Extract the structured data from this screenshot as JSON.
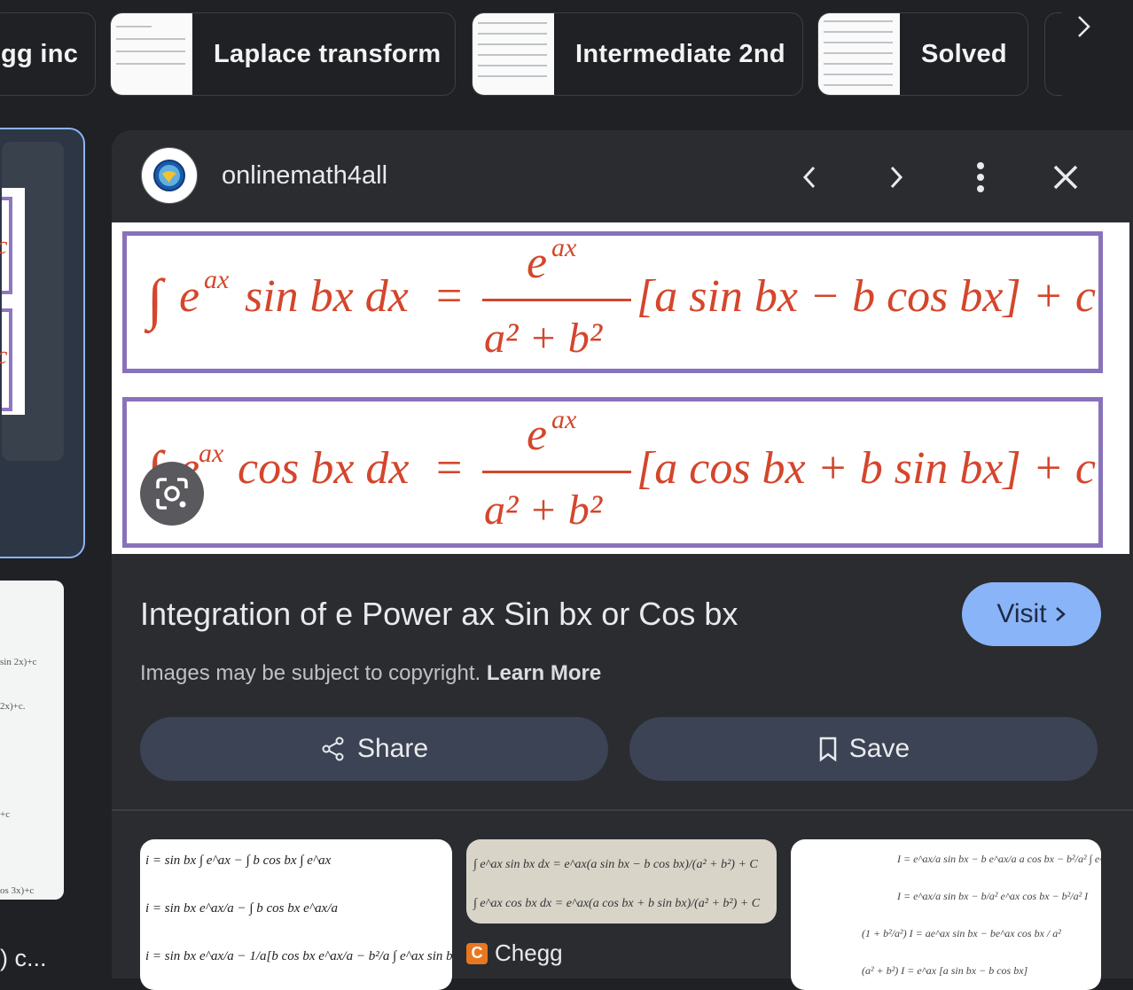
{
  "chips": [
    {
      "label": "gg inc"
    },
    {
      "label": "Laplace transform"
    },
    {
      "label": "Intermediate 2nd"
    },
    {
      "label": "Solved"
    }
  ],
  "left_card": {
    "line1": "c",
    "line2": "c",
    "caption": ") c..."
  },
  "left_bottom": {
    "l1": "sin 2x)+c",
    "l2": "2x)+c.",
    "l3": "+c",
    "l4": "os 3x)+c"
  },
  "panel": {
    "source_name": "onlinemath4all",
    "formula_top": {
      "integrand": "e",
      "exp": "ax",
      "mid": "sin bx dx",
      "eq": "=",
      "num": "e",
      "num_exp": "ax",
      "den": "a² + b²",
      "bracket": "[a sin bx − b cos bx] + c"
    },
    "formula_bottom": {
      "integrand": "e",
      "exp": "ax",
      "mid": "cos bx dx",
      "eq": "=",
      "num": "e",
      "num_exp": "ax",
      "den": "a² + b²",
      "bracket": "[a cos bx + b sin bx] + c"
    },
    "title": "Integration of e Power ax Sin bx or Cos bx",
    "visit_label": "Visit",
    "copyright": "Images may be subject to copyright.",
    "learn_more": "Learn More",
    "share_label": "Share",
    "save_label": "Save"
  },
  "related": [
    {
      "source": ""
    },
    {
      "source": "Chegg"
    },
    {
      "source": ""
    }
  ],
  "colors": {
    "accent": "#8ab4f8",
    "formula_red": "#d4462c",
    "frame_purple": "#8872bb"
  }
}
